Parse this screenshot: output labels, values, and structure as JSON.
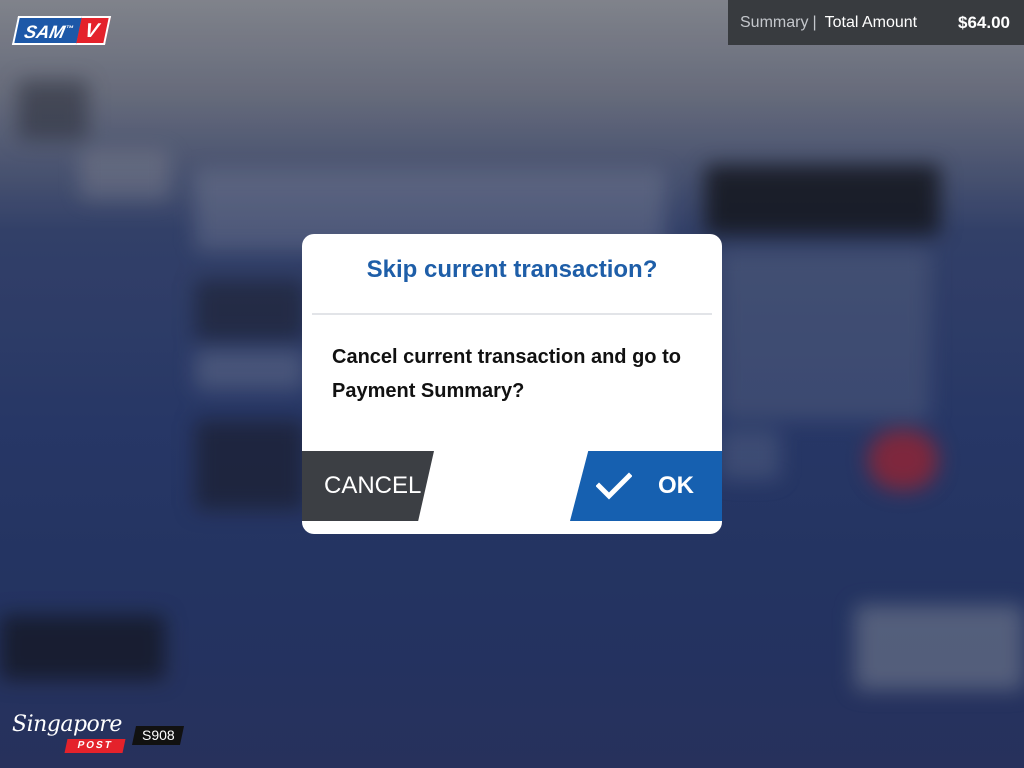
{
  "app": {
    "logo_text_left": "SAM",
    "logo_tm": "™",
    "logo_text_right": "V"
  },
  "summary": {
    "label": "Summary",
    "separator": "|",
    "total_label": "Total Amount",
    "total_value": "$64.00"
  },
  "dialog": {
    "title": "Skip current transaction?",
    "message": "Cancel current transaction and go to Payment Summary?",
    "cancel_label": "CANCEL",
    "ok_label": "OK"
  },
  "footer": {
    "brand_script": "Singapore",
    "brand_post": "POST",
    "terminal_id": "S908"
  },
  "colors": {
    "accent_blue": "#1660b0",
    "title_blue": "#1e5ea8",
    "brand_red": "#e4222b",
    "cancel_dark": "#3c3f44"
  }
}
